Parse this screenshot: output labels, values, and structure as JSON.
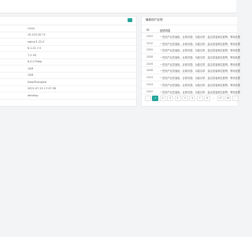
{
  "info": {
    "rows": [
      "Linux",
      "10.203.30.72",
      "nginx/1.22.0",
      "8.1.41.7.0",
      "7.2.26",
      "8.0.0 Prelp",
      "10M",
      "10M",
      "Asia/Shanghai",
      "2022-07-15 17:47:58",
      "develop"
    ]
  },
  "feedback": {
    "title": "最新用户反馈",
    "col_id": "ID",
    "col_content": "反馈内容",
    "row_text": "一些用户反馈面板，反映问题、功能请求、建议或者满意度等，等待处理",
    "ids": [
      "2005",
      "2010",
      "2009",
      "2008",
      "2026",
      "2006",
      "2003",
      "2004",
      "2002"
    ],
    "pages": [
      "‹",
      "1",
      "2",
      "3",
      "4",
      "5",
      "6",
      "7",
      "8",
      "…",
      "17",
      "18",
      "›"
    ],
    "active_page": "1"
  },
  "colors": {
    "accent": "#26a69a"
  }
}
